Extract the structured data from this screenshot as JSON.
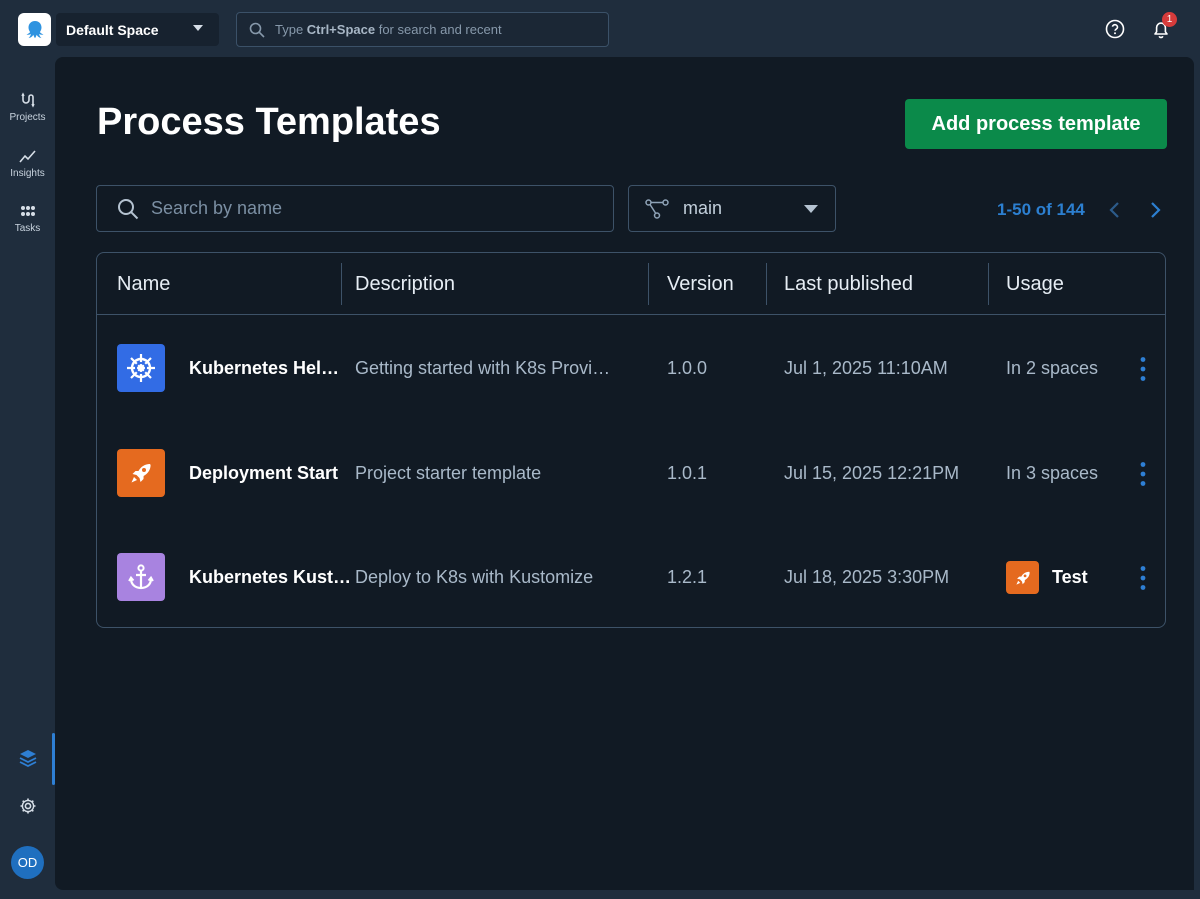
{
  "topbar": {
    "space_name": "Default Space",
    "search_prefix": "Type ",
    "search_shortcut": "Ctrl+Space",
    "search_suffix": " for search and recent",
    "notification_count": "1"
  },
  "sidenav": {
    "items": [
      {
        "label": "Projects",
        "icon": "projects-icon"
      },
      {
        "label": "Insights",
        "icon": "insights-icon"
      },
      {
        "label": "Tasks",
        "icon": "tasks-icon"
      }
    ],
    "avatar_initials": "OD"
  },
  "main": {
    "title": "Process Templates",
    "add_button": "Add process template",
    "search_placeholder": "Search by name",
    "branch": "main",
    "pager": "1-50 of 144"
  },
  "table": {
    "columns": [
      "Name",
      "Description",
      "Version",
      "Last published",
      "Usage"
    ],
    "rows": [
      {
        "name": "Kubernetes Hel…",
        "description": "Getting started with K8s Provi…",
        "version": "1.0.0",
        "published": "Jul 1, 2025 11:10AM",
        "usage": "In 2 spaces",
        "icon": "helm-wheel-icon",
        "icon_color": "#326ce5"
      },
      {
        "name": "Deployment Start",
        "description": "Project starter template",
        "version": "1.0.1",
        "published": "Jul 15, 2025 12:21PM",
        "usage": "In 3 spaces",
        "icon": "rocket-icon",
        "icon_color": "#e56a1f"
      },
      {
        "name": "Kubernetes Kust…",
        "description": "Deploy to K8s with Kustomize",
        "version": "1.2.1",
        "published": "Jul 18, 2025 3:30PM",
        "usage": "Test",
        "icon": "anchor-icon",
        "icon_color": "#a883e0"
      }
    ]
  },
  "colors": {
    "accent": "#2c7fd0",
    "primary_button": "#0b8a4a",
    "badge": "#d63b3b"
  }
}
